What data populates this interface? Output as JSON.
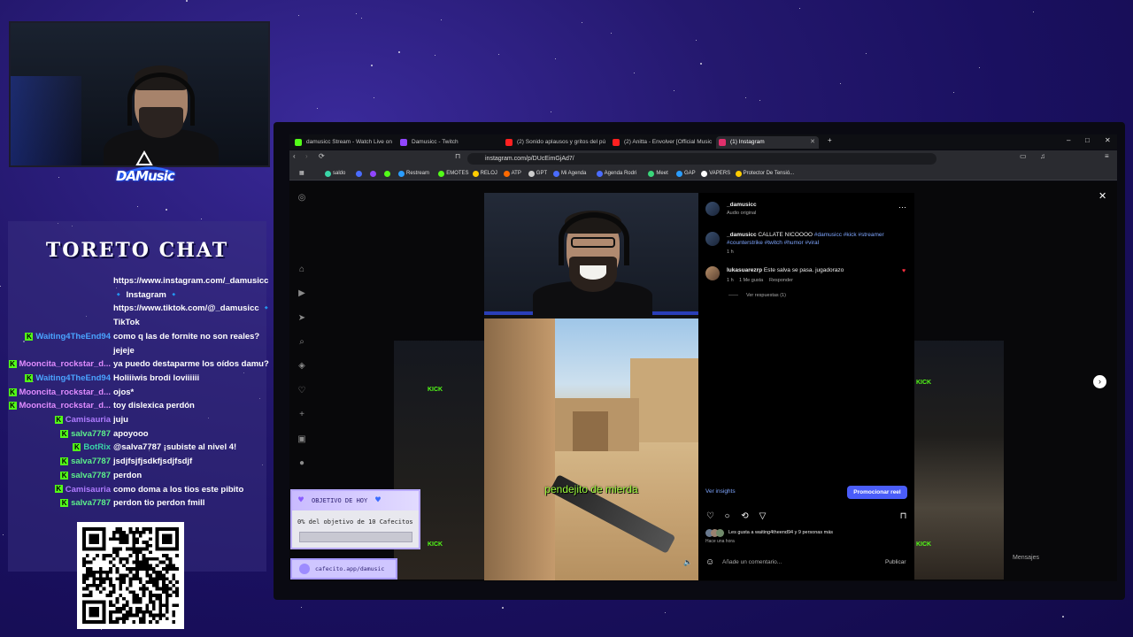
{
  "chat": {
    "title": "TORETO CHAT",
    "messages": [
      {
        "name": "",
        "text": "https://www.instagram.com/_damusicc",
        "name_color": "#ffffff",
        "badge": false
      },
      {
        "name": "",
        "text": "🔹 Instagram 🔹",
        "name_color": "#ffffff",
        "badge": false
      },
      {
        "name": "",
        "text": "https://www.tiktok.com/@_damusicc 🔹",
        "name_color": "#ffffff",
        "badge": false
      },
      {
        "name": "",
        "text": "TikTok",
        "name_color": "#ffffff",
        "badge": false
      },
      {
        "name": "Waiting4TheEnd94",
        "text": "como q las de fornite no son reales?",
        "name_color": "#4aa3ff",
        "badge": true
      },
      {
        "name": "",
        "text": "jejeje",
        "name_color": "#ffffff",
        "badge": false
      },
      {
        "name": "Mooncita_rockstar_d...",
        "text": "ya puedo destaparme los oídos damu?",
        "name_color": "#e08cff",
        "badge": true
      },
      {
        "name": "Waiting4TheEnd94",
        "text": "Holiiiwis brodi loviiiiii",
        "name_color": "#4aa3ff",
        "badge": true
      },
      {
        "name": "Mooncita_rockstar_d...",
        "text": "ojos*",
        "name_color": "#e08cff",
        "badge": true
      },
      {
        "name": "Mooncita_rockstar_d...",
        "text": "toy dislexica perdón",
        "name_color": "#e08cff",
        "badge": true
      },
      {
        "name": "Camisauria",
        "text": "juju",
        "name_color": "#b07cff",
        "badge": true
      },
      {
        "name": "salva7787",
        "text": "apoyooo",
        "name_color": "#5cf08a",
        "badge": true
      },
      {
        "name": "BotRix",
        "text": "@salva7787 ¡subiste al nivel 4!",
        "name_color": "#3ad6a8",
        "badge": true
      },
      {
        "name": "salva7787",
        "text": "jsdjfsjfjsdkfjsdjfsdjf",
        "name_color": "#5cf08a",
        "badge": true
      },
      {
        "name": "salva7787",
        "text": "perdon",
        "name_color": "#5cf08a",
        "badge": true
      },
      {
        "name": "Camisauria",
        "text": "como doma a los tios este pibito",
        "name_color": "#b07cff",
        "badge": true
      },
      {
        "name": "salva7787",
        "text": "perdon tio perdon fmill",
        "name_color": "#5cf08a",
        "badge": true
      }
    ]
  },
  "logo": {
    "text": "DAMusic"
  },
  "browser": {
    "tabs": [
      {
        "label": "damusicc Stream - Watch Live on",
        "color": "#53fc18",
        "active": false
      },
      {
        "label": "Damusicc - Twitch",
        "color": "#9146ff",
        "active": false
      },
      {
        "label": "(2) Sonido aplausos y gritos del públ",
        "color": "#ff2020",
        "active": false
      },
      {
        "label": "(2) Anitta - Envolver [Official Music V",
        "color": "#ff2020",
        "active": false
      },
      {
        "label": "(1) Instagram",
        "color": "#e1306c",
        "active": true
      }
    ],
    "url": "instagram.com/p/DUcEimGjAd7/",
    "bookmarks": [
      {
        "label": "saldo",
        "color": "#3ad6a8"
      },
      {
        "label": "",
        "color": "#4a6cff"
      },
      {
        "label": "",
        "color": "#9146ff"
      },
      {
        "label": "",
        "color": "#53fc18"
      },
      {
        "label": "Restream",
        "color": "#2a9dff"
      },
      {
        "label": "EMOTES",
        "color": "#53fc18"
      },
      {
        "label": "RELOJ",
        "color": "#ffcc00"
      },
      {
        "label": "ATP",
        "color": "#ff6a00"
      },
      {
        "label": "GPT",
        "color": "#cccccc"
      },
      {
        "label": "Mi Agenda",
        "color": "#4a6cff"
      },
      {
        "label": "Agenda Rodri",
        "color": "#4a6cff"
      },
      {
        "label": "Meet",
        "color": "#3ad67a"
      },
      {
        "label": "GAP",
        "color": "#2a9dff"
      },
      {
        "label": "VAPERS",
        "color": "#ffffff"
      },
      {
        "label": "Protector De Tensió...",
        "color": "#ffcc00"
      }
    ]
  },
  "post": {
    "username": "_damusicc",
    "audio": "Audio original",
    "caption_user": "_damusicc",
    "caption_text": "CALLATE NICOOOO",
    "caption_tags_1": "#damusicc #kick #streamer",
    "caption_tags_2": "#counterstrike #twitch #humor #viral",
    "caption_time": "1 h",
    "comment_user": "lukasuarezrp",
    "comment_text": "Este salva se pasa. jugadorazo",
    "comment_time": "1 h",
    "comment_likes": "1 Me gusta",
    "comment_reply": "Responder",
    "view_replies": "Ver respuestas (1)",
    "insights": "Ver insights",
    "promote": "Promocionar reel",
    "likes_text": "Les gusta a waiting4theend94 y 9 personas más",
    "posted": "Hace una hora",
    "comment_placeholder": "Añade un comentario...",
    "publish": "Publicar"
  },
  "reel": {
    "subtitle": "pendejito de mierda"
  },
  "background_labels": {
    "kick": "KICK",
    "kick_url": "kick.com/damusicc",
    "messages": "Mensajes"
  },
  "overlays": {
    "goal_title": "OBJETIVO DE HOY",
    "goal_text": "0% del objetivo de 10 Cafecitos",
    "goal_progress": 0,
    "cafecito": "cafecito.app/damusic"
  },
  "colors": {
    "accent_blue": "#4a5df9",
    "kick_green": "#53fc18",
    "subtitle_green": "#9dfc3c"
  }
}
